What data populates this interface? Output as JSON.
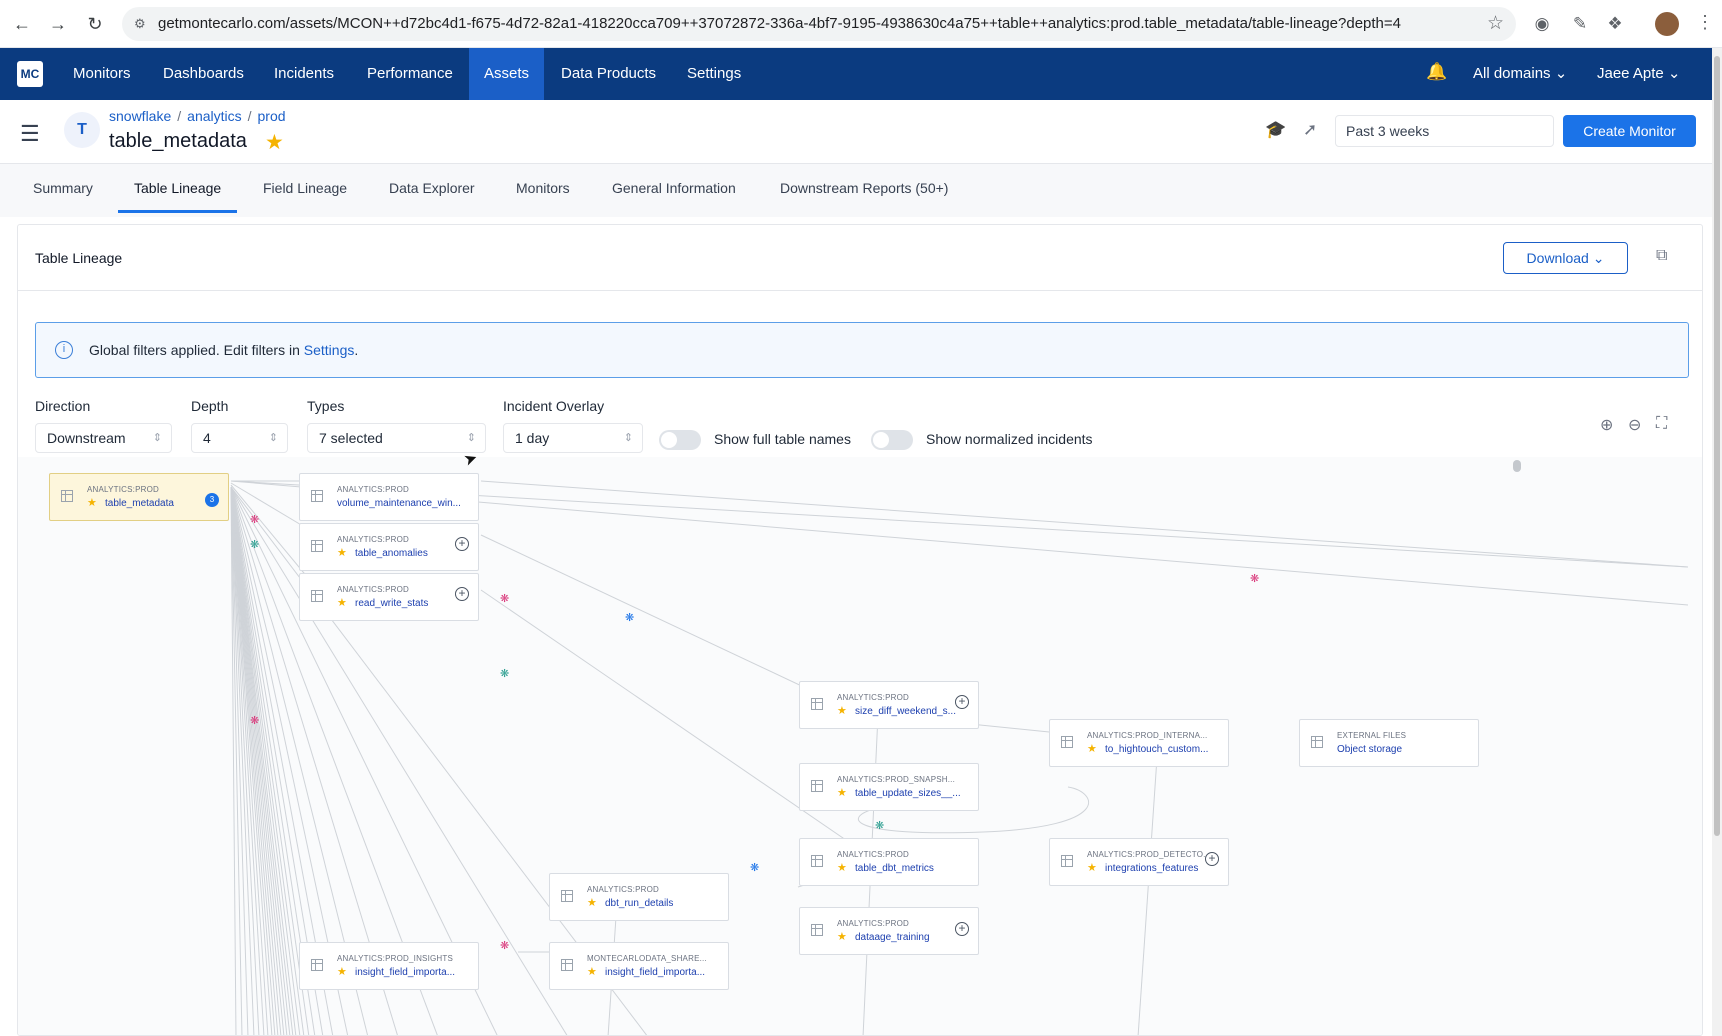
{
  "browser": {
    "url": "getmontecarlo.com/assets/MCON++d72bc4d1-f675-4d72-82a1-418220cca709++37072872-336a-4bf7-9195-4938630c4a75++table++analytics:prod.table_metadata/table-lineage?depth=4"
  },
  "app": {
    "logo": "MC",
    "nav": [
      "Monitors",
      "Dashboards",
      "Incidents",
      "Performance",
      "Assets",
      "Data Products",
      "Settings"
    ],
    "active_nav": "Assets",
    "domains_label": "All domains",
    "user_name": "Jaee Apte"
  },
  "header": {
    "avatar_letter": "T",
    "breadcrumb": [
      "snowflake",
      "analytics",
      "prod"
    ],
    "title": "table_metadata",
    "time_range": "Past 3 weeks",
    "create_monitor": "Create Monitor"
  },
  "tabs": [
    "Summary",
    "Table Lineage",
    "Field Lineage",
    "Data Explorer",
    "Monitors",
    "General Information",
    "Downstream Reports (50+)"
  ],
  "active_tab": "Table Lineage",
  "panel": {
    "title": "Table Lineage",
    "download": "Download",
    "banner_text": "Global filters applied. Edit filters in ",
    "banner_link": "Settings",
    "banner_suffix": "."
  },
  "controls": {
    "direction": {
      "label": "Direction",
      "value": "Downstream"
    },
    "depth": {
      "label": "Depth",
      "value": "4"
    },
    "types": {
      "label": "Types",
      "value": "7 selected"
    },
    "incident_overlay": {
      "label": "Incident Overlay",
      "value": "1 day"
    },
    "toggle_full_names": "Show full table names",
    "toggle_normalized": "Show normalized incidents"
  },
  "lineage": {
    "nodes": [
      {
        "id": "n0",
        "schema": "ANALYTICS:PROD",
        "name": "table_metadata",
        "badge": "3"
      },
      {
        "id": "n1",
        "schema": "ANALYTICS:PROD",
        "name": "volume_maintenance_win..."
      },
      {
        "id": "n2",
        "schema": "ANALYTICS:PROD",
        "name": "table_anomalies"
      },
      {
        "id": "n3",
        "schema": "ANALYTICS:PROD",
        "name": "read_write_stats"
      },
      {
        "id": "n4",
        "schema": "ANALYTICS:PROD",
        "name": "size_diff_weekend_s..."
      },
      {
        "id": "n5",
        "schema": "ANALYTICS:PROD_SNAPSH...",
        "name": "table_update_sizes__..."
      },
      {
        "id": "n6",
        "schema": "ANALYTICS:PROD",
        "name": "table_dbt_metrics"
      },
      {
        "id": "n7",
        "schema": "ANALYTICS:PROD",
        "name": "dataage_training"
      },
      {
        "id": "n8",
        "schema": "ANALYTICS:PROD",
        "name": "dbt_run_details"
      },
      {
        "id": "n9",
        "schema": "ANALYTICS:PROD_INSIGHTS",
        "name": "insight_field_importa..."
      },
      {
        "id": "n10",
        "schema": "MONTECARLODATA_SHARE...",
        "name": "insight_field_importa..."
      },
      {
        "id": "n11",
        "schema": "ANALYTICS:PROD_INTERNA...",
        "name": "to_hightouch_custom..."
      },
      {
        "id": "n12",
        "schema": "ANALYTICS:PROD_DETECTO...",
        "name": "integrations_features"
      },
      {
        "id": "n13",
        "schema": "EXTERNAL FILES",
        "name": "Object storage"
      }
    ]
  }
}
